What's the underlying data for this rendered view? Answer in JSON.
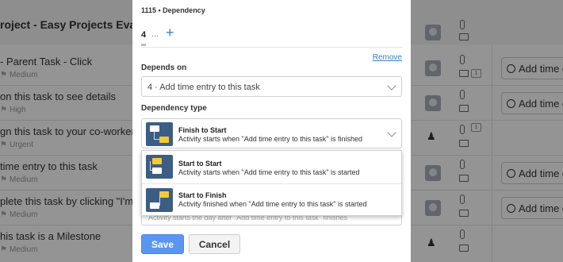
{
  "background": {
    "project_title": "roject - Easy Projects Evaluatio",
    "tasks": [
      {
        "title": "- Parent Task - Click",
        "priority": "Medium"
      },
      {
        "title": "on this task to see details",
        "priority": "High"
      },
      {
        "title": "gn this task to your co-worker",
        "priority": "Urgent"
      },
      {
        "title": "time entry to this task",
        "priority": "Medium"
      },
      {
        "title": "plete this task by clicking \"I'm Do",
        "priority": "Medium"
      },
      {
        "title": "his task is a Milestone",
        "priority": "Medium"
      }
    ],
    "add_time_label": "Add time e",
    "badge_count": "1"
  },
  "modal": {
    "header": "1115 • Dependency",
    "task_number": "4",
    "ellipsis": "...",
    "add_symbol": "+",
    "remove_label": "Remove",
    "depends_on_label": "Depends on",
    "depends_on_value": "4 · Add time entry to this task",
    "dependency_type_label": "Dependency type",
    "selected_type": {
      "title": "Finish to Start",
      "description": "Activity starts when \"Add time entry to this task\" is finished"
    },
    "options": [
      {
        "title": "Start to Start",
        "description": "Activity starts when \"Add time entry to this task\" is started"
      },
      {
        "title": "Start to Finish",
        "description": "Activity finished when \"Add time entry to this task\" is started"
      }
    ],
    "obscured_description": "Activity starts the day after \"Add time entry to this task\" finishes",
    "save_label": "Save",
    "cancel_label": "Cancel"
  },
  "colors": {
    "accent": "#3b82c4",
    "save_button": "#5b95f2",
    "icon_bg": "#3c5e85",
    "icon_highlight": "#f5cb2f"
  }
}
